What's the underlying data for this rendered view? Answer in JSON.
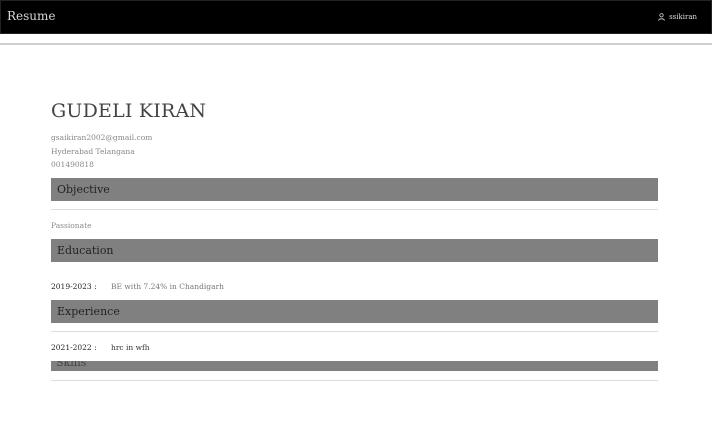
{
  "navbar": {
    "brand": "Resume",
    "user": "ssikiran"
  },
  "profile": {
    "name": "GUDELI KIRAN",
    "email": "gsaikiran2002@gmail.com",
    "location": "Hyderabad Telangana",
    "phone": "001490818"
  },
  "sections": {
    "objective": {
      "title": "Objective",
      "text": "Passionate"
    },
    "education": {
      "title": "Education",
      "items": [
        {
          "years": "2019-2023 :",
          "detail": "BE with 7.24% in Chandigarh"
        }
      ]
    },
    "experience": {
      "title": "Experience",
      "items": [
        {
          "years": "2021-2022 :",
          "detail": "hrc in wfh"
        }
      ]
    },
    "skills": {
      "title": "Skills"
    }
  },
  "icons": {
    "user": "user-icon"
  },
  "colors": {
    "navbar": "#000000",
    "section_bar": "#808080",
    "background": "#ffffff"
  }
}
